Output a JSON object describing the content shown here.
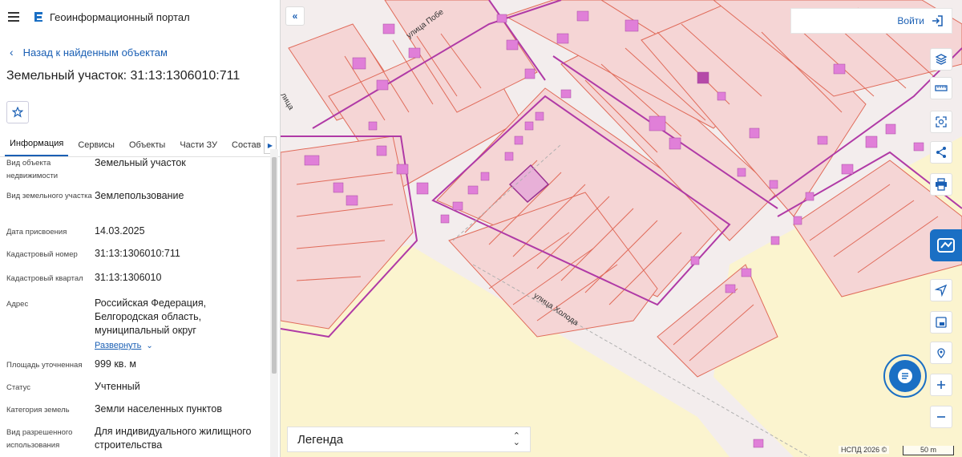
{
  "header": {
    "title": "Геоинформационный портал"
  },
  "nav": {
    "back_label": "Назад к найденным объектам"
  },
  "object": {
    "title": "Земельный участок: 31:13:1306010:711"
  },
  "tabs": [
    "Информация",
    "Сервисы",
    "Объекты",
    "Части ЗУ",
    "Состав"
  ],
  "active_tab": "Информация",
  "info": {
    "type_label": "Вид объекта недвижимости",
    "type_value": "Земельный участок",
    "use_kind_label": "Вид земельного участка",
    "use_kind_value": "Землепользование",
    "date_label": "Дата присвоения",
    "date_value": "14.03.2025",
    "cadnum_label": "Кадастровый номер",
    "cadnum_value": "31:13:1306010:711",
    "quarter_label": "Кадастровый квартал",
    "quarter_value": "31:13:1306010",
    "address_label": "Адрес",
    "address_value": "Российская Федерация, Белгородская область, муниципальный округ",
    "expand_label": "Развернуть",
    "area_label": "Площадь уточненная",
    "area_value": "999 кв. м",
    "status_label": "Статус",
    "status_value": "Учтенный",
    "category_label": "Категория земель",
    "category_value": "Земли населенных пунктов",
    "permitted_label": "Вид разрешенного использования",
    "permitted_value": "Для индивидуального жилищного строительства"
  },
  "map": {
    "login_label": "Войти",
    "legend_label": "Легенда",
    "street_1": "улица Побе",
    "street_2": "улица Холода",
    "street_3": "лица",
    "copyright": "НСПД 2026 ©",
    "scale_label": "50 m"
  },
  "colors": {
    "accent": "#1a6fc4",
    "parcel_fill": "#f5d5d5",
    "parcel_stroke": "#e06b5a",
    "building_fill": "#e07fd8",
    "quarter_stroke": "#b03aa6",
    "selected_fill": "#e8b0d8",
    "farmland_fill": "#fbf4cf"
  },
  "icons": [
    "menu-icon",
    "portal-logo-icon",
    "chevron-left-icon",
    "star-icon",
    "chevron-right-icon",
    "chevron-down-icon",
    "double-chevron-left-icon",
    "login-icon",
    "layers-icon",
    "ruler-icon",
    "select-area-icon",
    "share-icon",
    "print-icon",
    "gis-services-icon",
    "navigation-icon",
    "basemap-icon",
    "location-pin-icon",
    "plus-icon",
    "minus-icon",
    "chat-icon",
    "up-down-icon"
  ]
}
